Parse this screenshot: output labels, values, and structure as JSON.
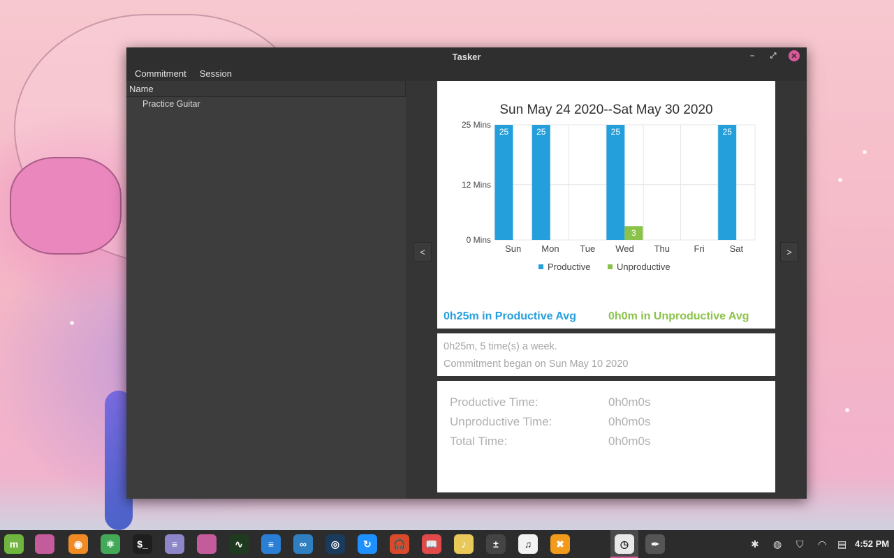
{
  "window": {
    "title": "Tasker",
    "menu": [
      "Commitment",
      "Session"
    ],
    "controls": {
      "minimize": "–",
      "maximize": "⤢",
      "close": "✕"
    }
  },
  "commitments": {
    "header": "Name",
    "items": [
      "Practice Guitar"
    ]
  },
  "nav": {
    "prev": "<",
    "next": ">"
  },
  "chart_data": {
    "type": "bar",
    "title": "Sun May 24 2020--Sat May 30 2020",
    "categories": [
      "Sun",
      "Mon",
      "Tue",
      "Wed",
      "Thu",
      "Fri",
      "Sat"
    ],
    "series": [
      {
        "name": "Productive",
        "color": "#259fdc",
        "values": [
          25,
          25,
          0,
          25,
          0,
          0,
          25
        ]
      },
      {
        "name": "Unproductive",
        "color": "#8bc34a",
        "values": [
          0,
          0,
          0,
          3,
          0,
          0,
          0
        ]
      }
    ],
    "yticks": [
      "0 Mins",
      "12 Mins",
      "25 Mins"
    ],
    "ytick_values": [
      0,
      12,
      25
    ],
    "ylim": [
      0,
      25
    ],
    "grid": true,
    "legend": "bottom"
  },
  "averages": {
    "productive": "0h25m in Productive Avg",
    "unproductive": "0h0m in Unproductive Avg"
  },
  "commitment_info": {
    "frequency": "0h25m, 5 time(s) a week.",
    "began": "Commitment began on Sun May 10 2020"
  },
  "session_stats": [
    {
      "label": "Productive Time:",
      "value": "0h0m0s"
    },
    {
      "label": "Unproductive Time:",
      "value": "0h0m0s"
    },
    {
      "label": "Total Time:",
      "value": "0h0m0s"
    }
  ],
  "taskbar": {
    "apps": [
      {
        "name": "mint-menu-icon",
        "glyph": "m",
        "color": "#6fb53f"
      },
      {
        "name": "show-desktop-icon",
        "glyph": "",
        "color": "#c45b9a"
      },
      {
        "name": "firefox-icon",
        "glyph": "◉",
        "color": "#f08a24"
      },
      {
        "name": "atom-icon",
        "glyph": "⚛",
        "color": "#43a858"
      },
      {
        "name": "terminal-icon",
        "glyph": "$_",
        "color": "#1e1e1e"
      },
      {
        "name": "text-editor-icon",
        "glyph": "≡",
        "color": "#8d86c9"
      },
      {
        "name": "files-icon",
        "glyph": "",
        "color": "#c45b9a"
      },
      {
        "name": "system-monitor-icon",
        "glyph": "∿",
        "color": "#1f3b1f"
      },
      {
        "name": "writer-icon",
        "glyph": "≡",
        "color": "#2a7fd4"
      },
      {
        "name": "reader-glasses-icon",
        "glyph": "∞",
        "color": "#2f7fc1"
      },
      {
        "name": "steam-icon",
        "glyph": "◎",
        "color": "#1b3b5c"
      },
      {
        "name": "refresh-app-icon",
        "glyph": "↻",
        "color": "#1e90ff"
      },
      {
        "name": "audio-recorder-icon",
        "glyph": "🎧",
        "color": "#d94a2a"
      },
      {
        "name": "book-reader-icon",
        "glyph": "📖",
        "color": "#e04a4a"
      },
      {
        "name": "music-note-icon",
        "glyph": "♪",
        "color": "#e8c95a"
      },
      {
        "name": "calculator-icon",
        "glyph": "±",
        "color": "#444444"
      },
      {
        "name": "music-player-icon",
        "glyph": "♫",
        "color": "#f2f2f2"
      },
      {
        "name": "game-x-icon",
        "glyph": "✖",
        "color": "#f29a1c"
      },
      {
        "name": "tasker-clock-icon",
        "glyph": "◷",
        "color": "#e8e8e8"
      },
      {
        "name": "inkscape-pen-icon",
        "glyph": "✒",
        "color": "#555555"
      }
    ],
    "clock": "4:52 PM"
  }
}
